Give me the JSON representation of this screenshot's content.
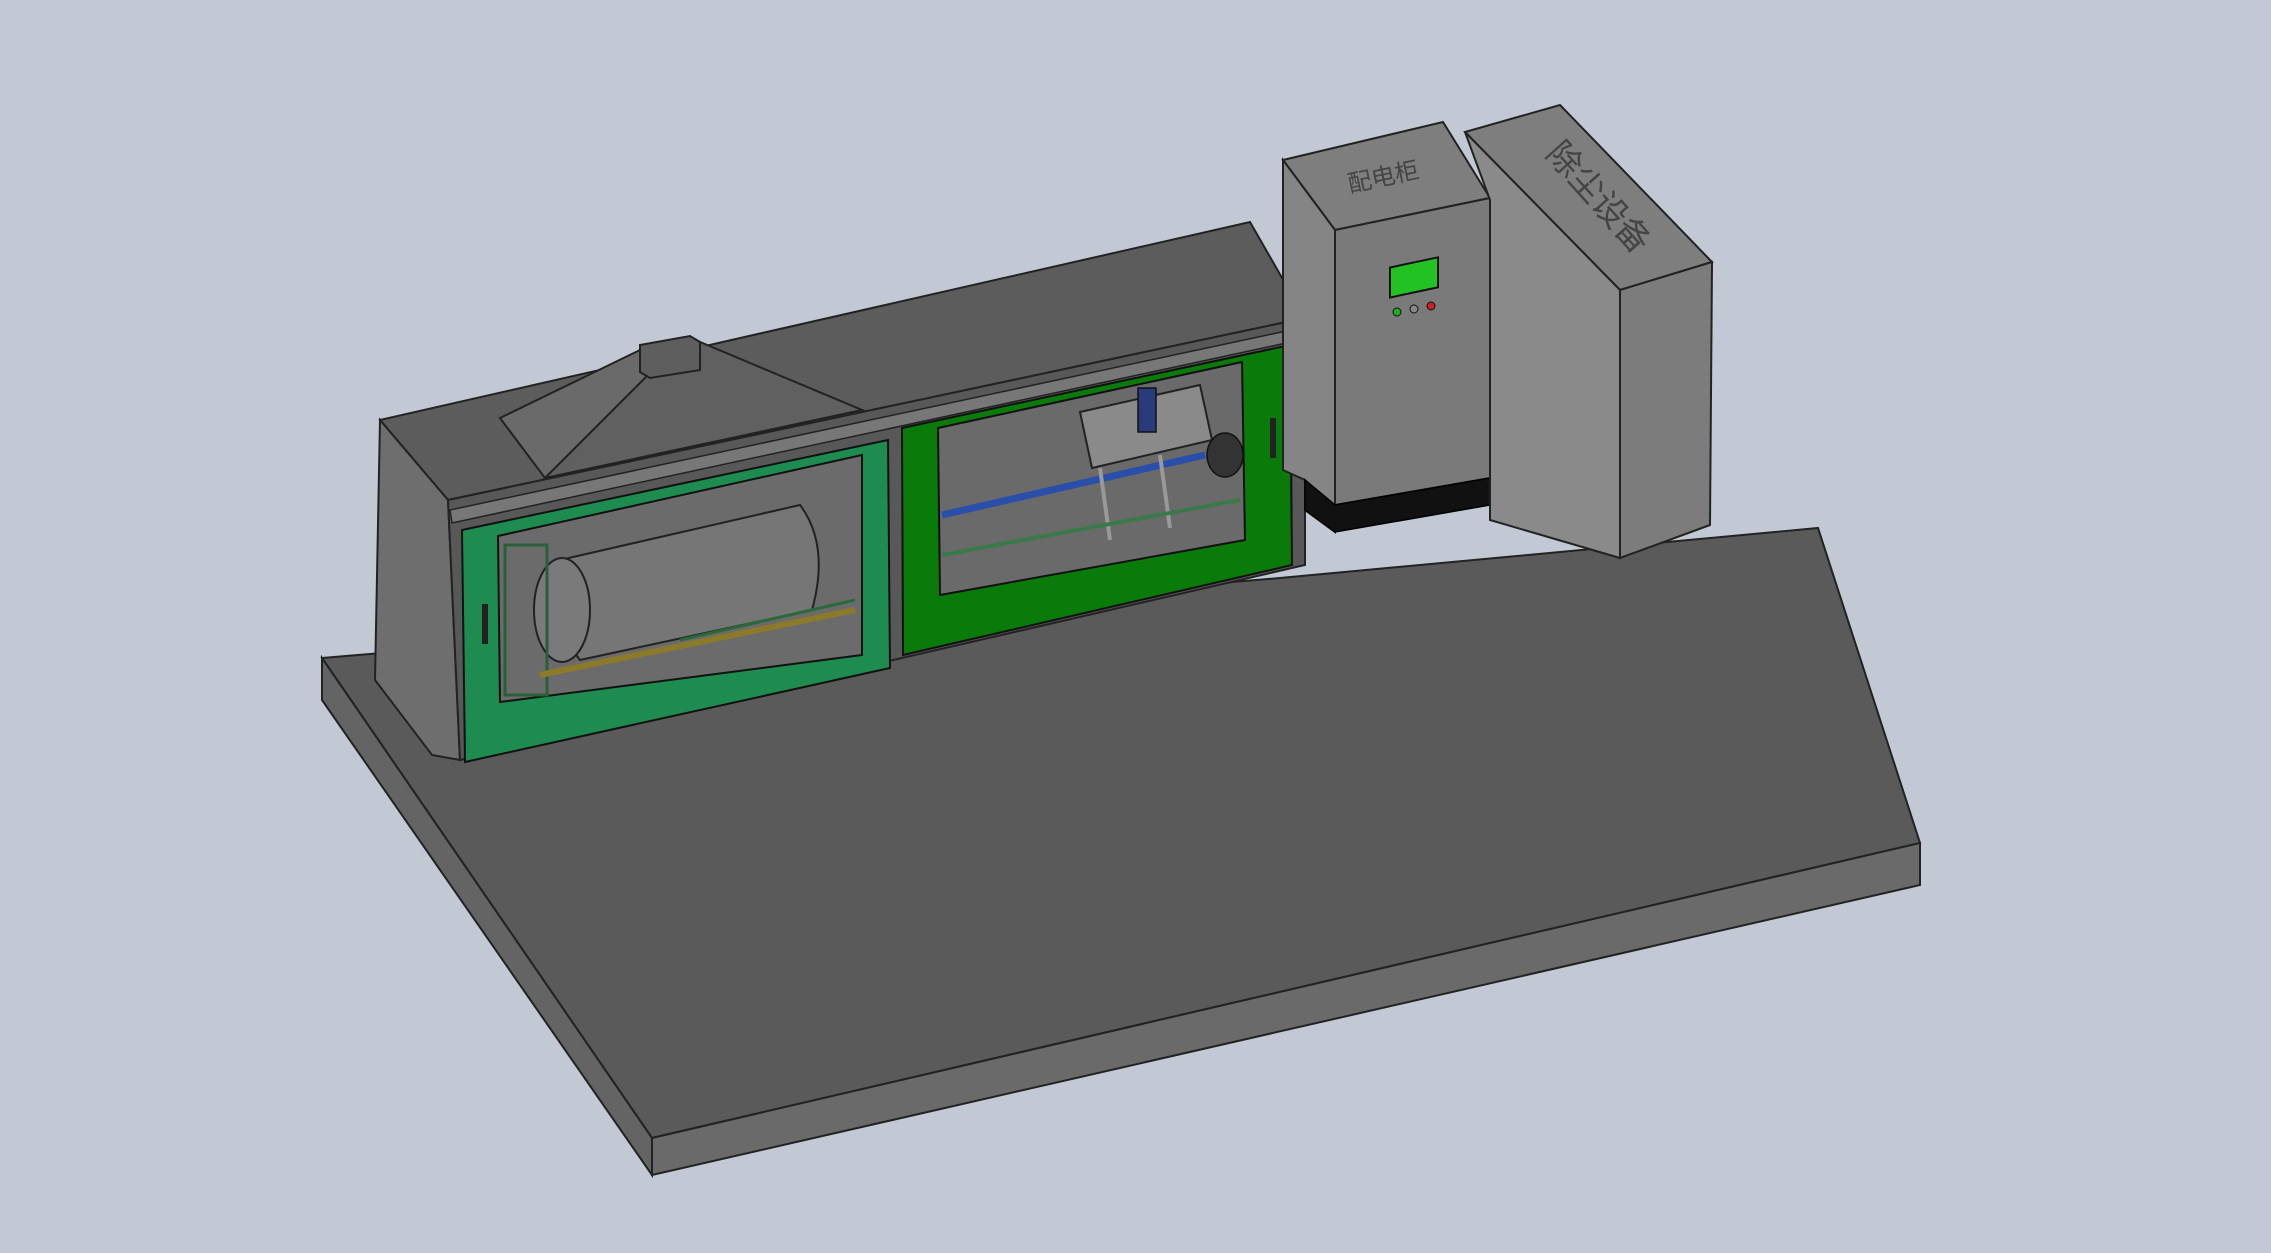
{
  "labels": {
    "cabinet_left": "配电柜",
    "cabinet_right": "除尘设备"
  },
  "colors": {
    "background": "#c2c8d4",
    "body_grey": "#5a5a5a",
    "door_green_dark": "#0a7a0a",
    "door_green_light": "#1e8c50",
    "display_green": "#22c222",
    "label_text": "#444444"
  },
  "indicators": [
    "green",
    "grey",
    "red"
  ]
}
